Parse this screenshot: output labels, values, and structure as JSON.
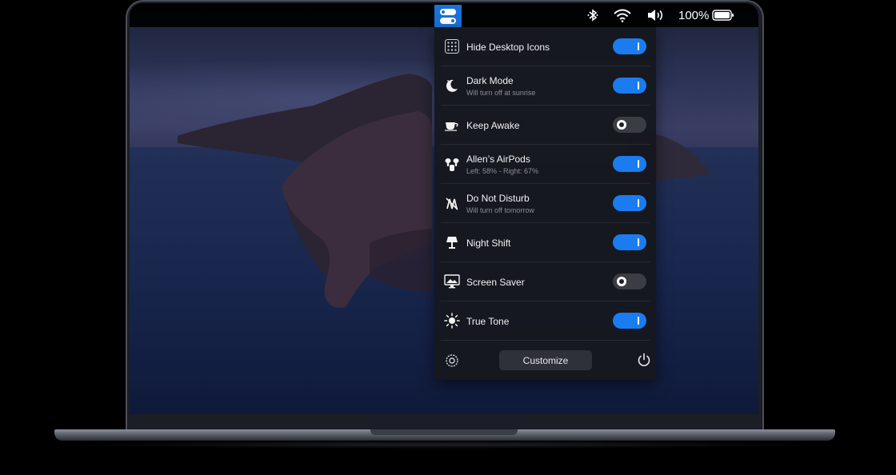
{
  "menubar": {
    "app_icon": "toggles-icon",
    "battery_percent": "100%",
    "status_icons": [
      "bluetooth-icon",
      "wifi-icon",
      "volume-icon",
      "battery-icon"
    ]
  },
  "panel": {
    "items": [
      {
        "label": "Hide Desktop Icons",
        "sub": "",
        "icon": "grid-icon",
        "on": true
      },
      {
        "label": "Dark Mode",
        "sub": "Will turn off at sunrise",
        "icon": "moon-icon",
        "on": true
      },
      {
        "label": "Keep Awake",
        "sub": "",
        "icon": "coffee-cup-icon",
        "on": false
      },
      {
        "label": "Allen’s AirPods",
        "sub": "Left: 58% - Right: 67%",
        "icon": "airpods-icon",
        "on": true
      },
      {
        "label": "Do Not Disturb",
        "sub": "Will turn off tomorrow",
        "icon": "do-not-disturb-icon",
        "on": true
      },
      {
        "label": "Night Shift",
        "sub": "",
        "icon": "lamp-icon",
        "on": true
      },
      {
        "label": "Screen Saver",
        "sub": "",
        "icon": "monitor-icon",
        "on": false
      },
      {
        "label": "True Tone",
        "sub": "",
        "icon": "sun-icon",
        "on": true
      }
    ],
    "footer": {
      "customize_label": "Customize",
      "settings_icon": "gear-icon",
      "power_icon": "power-icon"
    }
  },
  "colors": {
    "accent": "#1a7cf0",
    "panel_bg": "#16181e",
    "toggle_off": "#3a3d44"
  }
}
